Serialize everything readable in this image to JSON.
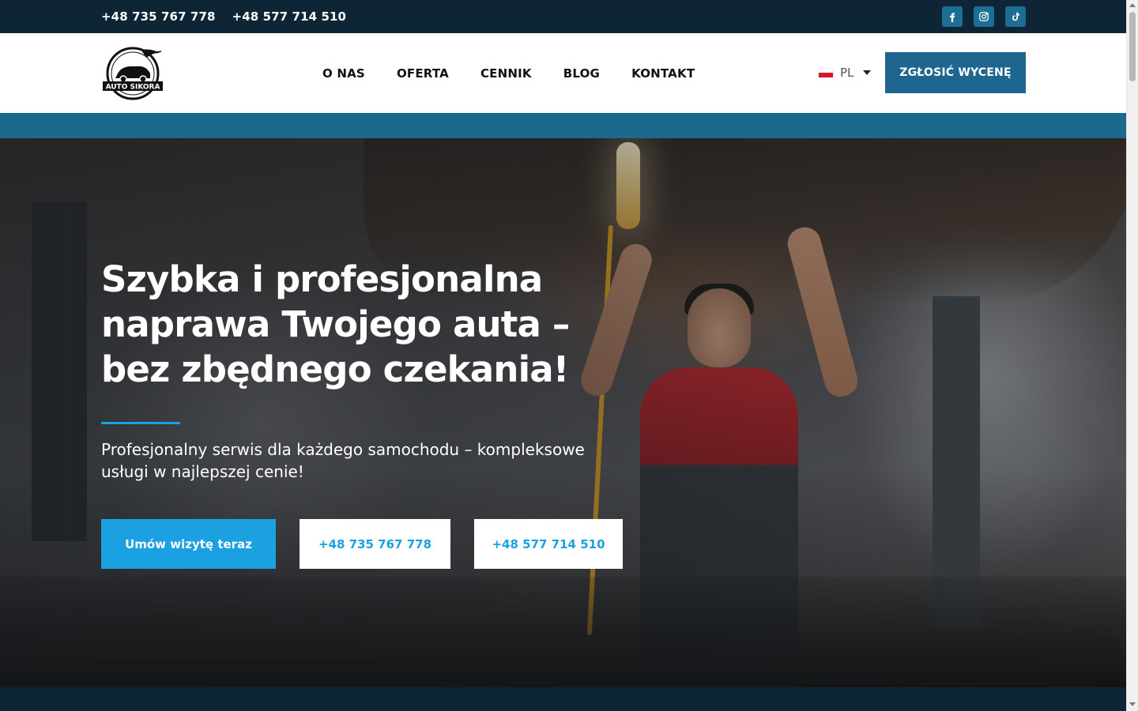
{
  "topbar": {
    "phone_1": "+48 735 767 778",
    "phone_2": "+48 577 714 510",
    "socials": [
      {
        "name": "facebook-icon",
        "glyph": "f"
      },
      {
        "name": "instagram-icon",
        "glyph": "ig"
      },
      {
        "name": "tiktok-icon",
        "glyph": "tt"
      }
    ]
  },
  "header": {
    "logo_text": "AUTO SIKORA",
    "nav": [
      "O NAS",
      "OFERTA",
      "CENNIK",
      "BLOG",
      "KONTAKT"
    ],
    "language": "PL",
    "cta_label": "ZGŁOSIĆ WYCENĘ"
  },
  "hero": {
    "title": "Szybka i profesjonalna naprawa Twojego auta – bez zbędnego czekania!",
    "subtitle": "Profesjonalny serwis dla każdego samochodu – kompleksowe usługi w najlepszej cenie!",
    "buttons": {
      "primary": "Umów wizytę teraz",
      "phone_1": "+48 735 767 778",
      "phone_2": "+48 577 714 510"
    }
  },
  "colors": {
    "topbar_bg": "#0d2534",
    "brand_blue": "#1e6690",
    "accent_blue": "#1ba0e2",
    "strip_blue": "#1b6a8e"
  }
}
